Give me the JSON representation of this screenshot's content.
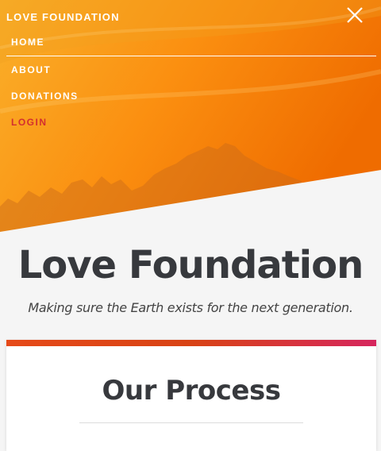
{
  "header": {
    "site_name": "LOVE FOUNDATION",
    "close_icon": "close-icon"
  },
  "nav": {
    "items": [
      {
        "label": "HOME"
      },
      {
        "label": "ABOUT"
      },
      {
        "label": "DONATIONS"
      },
      {
        "label": "LOGIN"
      }
    ],
    "login_color": "#d32f2f"
  },
  "hero": {
    "colors": [
      "#f9a825",
      "#fb8c00",
      "#e65100"
    ]
  },
  "main": {
    "title": "Love Foundation",
    "subtitle": "Making sure the Earth exists for the next generation."
  },
  "process_card": {
    "title": "Our Process",
    "accent_colors": [
      "#e64a19",
      "#d6265e"
    ]
  }
}
